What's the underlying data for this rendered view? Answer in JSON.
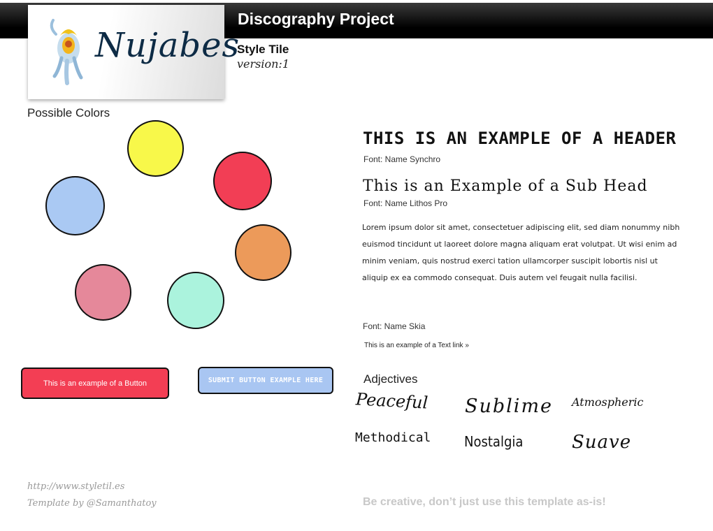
{
  "header": {
    "title": "Discography Project"
  },
  "logo": {
    "text": "Nujabes"
  },
  "tile": {
    "title": "Style Tile",
    "version": "version:1"
  },
  "colors": {
    "label": "Possible Colors",
    "swatches": [
      "#f8f84a",
      "#f23e55",
      "#aac9f3",
      "#ec9a5a",
      "#e5889a",
      "#abf3dd"
    ]
  },
  "typography": {
    "header_example": "THIS IS AN EXAMPLE OF A HEADER",
    "header_font": "Font: Name Synchro",
    "subhead_example": "This is an Example of a Sub Head",
    "subhead_font": "Font: Name Lithos Pro",
    "body_text": "Lorem ipsum dolor sit amet, consectetuer adipiscing elit, sed diam nonummy nibh euismod tincidunt ut laoreet dolore magna aliquam erat volutpat. Ut wisi enim ad minim veniam, quis nostrud exerci tation ullamcorper suscipit lobortis nisl ut aliquip ex ea commodo consequat. Duis autem vel feugait nulla facilisi.",
    "body_font": "Font: Name Skia",
    "text_link": "This is an example of a Text link »"
  },
  "buttons": {
    "example": "This is an example of a Button",
    "submit": "SUBMIT BUTTON EXAMPLE HERE"
  },
  "adjectives": {
    "label": "Adjectives",
    "items": [
      "Peaceful",
      "Sublime",
      "Atmospheric",
      "Methodical",
      "Nostalgia",
      "Suave"
    ]
  },
  "footer": {
    "url": "http://www.styletil.es",
    "credit": "Template by @Samanthatoy",
    "note": "Be creative, don’t just use this template as-is!"
  }
}
